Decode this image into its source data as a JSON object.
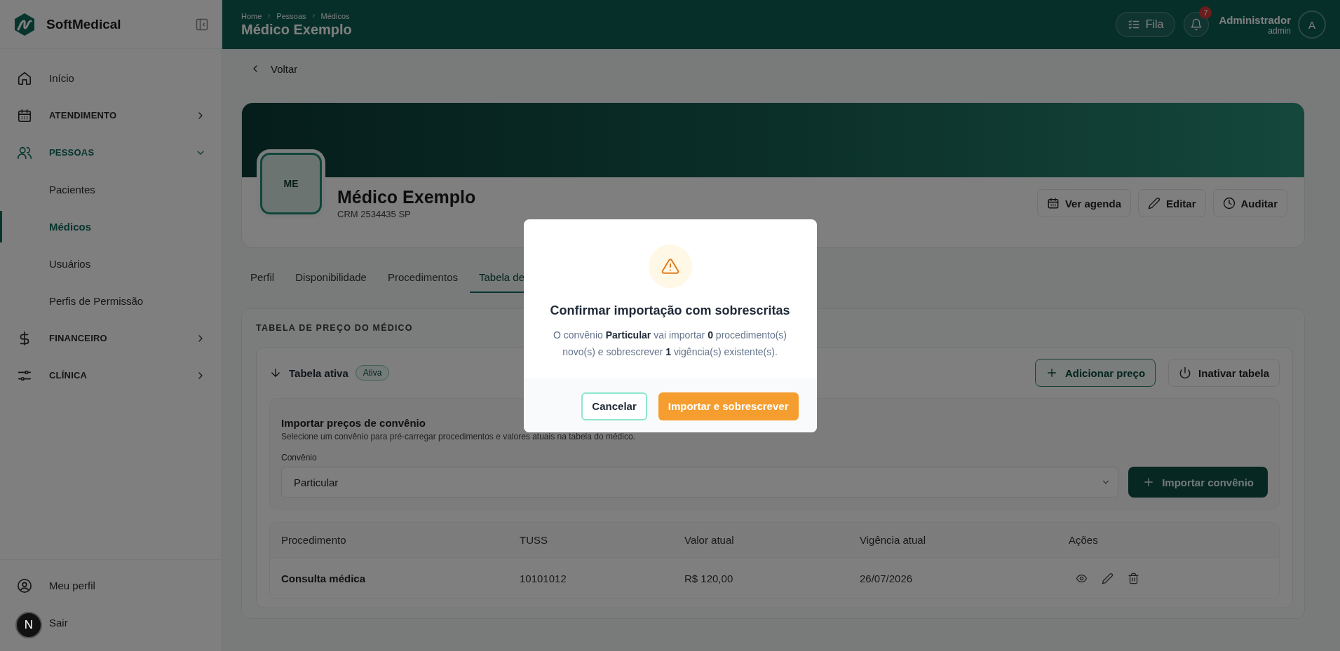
{
  "sidebar": {
    "brand": "SoftMedical",
    "items": [
      {
        "kind": "link",
        "label": "Início",
        "selected": false
      },
      {
        "kind": "group",
        "label": "ATENDIMENTO",
        "selected": false,
        "expanded": false
      },
      {
        "kind": "group",
        "label": "PESSOAS",
        "selected": true,
        "expanded": true,
        "children": [
          {
            "label": "Pacientes",
            "selected": false
          },
          {
            "label": "Médicos",
            "selected": true
          },
          {
            "label": "Usuários",
            "selected": false
          },
          {
            "label": "Perfis de Permissão",
            "selected": false
          }
        ]
      },
      {
        "kind": "group",
        "label": "FINANCEIRO",
        "selected": false,
        "expanded": false
      },
      {
        "kind": "group",
        "label": "CLÍNICA",
        "selected": false,
        "expanded": false
      }
    ],
    "footer_items": [
      {
        "label": "Meu perfil"
      },
      {
        "label": "Sair"
      }
    ]
  },
  "header": {
    "breadcrumbs": [
      "Home",
      "Pessoas",
      "Médicos"
    ],
    "title": "Médico Exemplo",
    "queue_button": "Fila",
    "notification_count": "7",
    "user": {
      "name": "Administrador",
      "role": "admin",
      "initial": "A"
    }
  },
  "back_link": "Voltar",
  "profile": {
    "initials": "ME",
    "name": "Médico Exemplo",
    "crm": "CRM 2534435 SP",
    "actions": [
      "Ver agenda",
      "Editar",
      "Auditar"
    ]
  },
  "tabs": [
    {
      "label": "Perfil",
      "selected": false
    },
    {
      "label": "Disponibilidade",
      "selected": false
    },
    {
      "label": "Procedimentos",
      "selected": false
    },
    {
      "label": "Tabela de",
      "selected": true
    }
  ],
  "price_section": {
    "heading": "TABELA DE PREÇO DO MÉDICO",
    "table_title": "Tabela ativa",
    "status": "Ativa",
    "actions": [
      {
        "label": "Adicionar preço",
        "kind": "accent"
      },
      {
        "label": "Inativar tabela",
        "kind": "plain"
      }
    ],
    "import": {
      "title": "Importar preços de convênio",
      "description": "Selecione um convênio para pré-carregar procedimentos e valores atuais na tabela do médico.",
      "field_label": "Convênio",
      "value": "Particular",
      "button": "Importar convênio"
    },
    "table": {
      "columns": [
        "Procedimento",
        "TUSS",
        "Valor atual",
        "Vigência atual",
        "Ações"
      ],
      "rows": [
        {
          "cells": [
            "Consulta médica",
            "10101012",
            "R$ 120,00",
            "26/07/2026"
          ]
        }
      ]
    }
  },
  "modal": {
    "title": "Confirmar importação com sobrescritas",
    "message": "O convênio **Particular** vai importar **0** procedimento(s) novo(s) e sobrescrever **1** vigência(s) existente(s).",
    "buttons": [
      {
        "label": "Cancelar",
        "kind": "secondary"
      },
      {
        "label": "Importar e sobrescrever",
        "kind": "primary"
      }
    ]
  },
  "dev_badge": "N"
}
